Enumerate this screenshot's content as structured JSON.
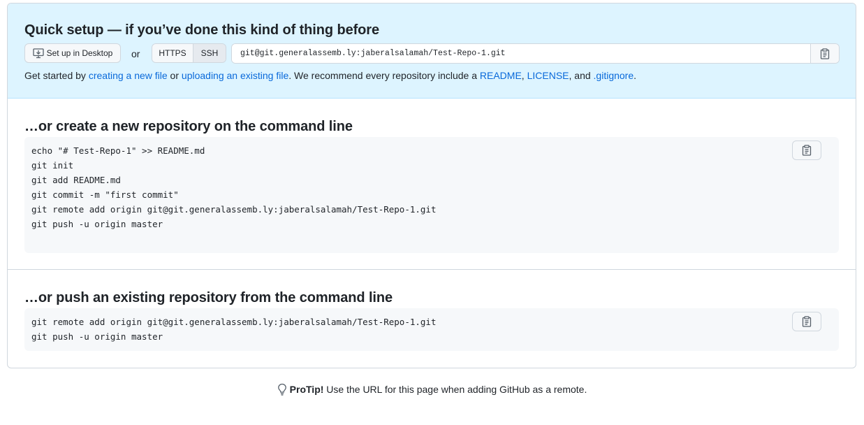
{
  "quick_setup": {
    "title": "Quick setup — if you’ve done this kind of thing before",
    "desktop_button_label": "Set up in Desktop",
    "or_label": "or",
    "protocols": [
      "HTTPS",
      "SSH"
    ],
    "selected_protocol": "SSH",
    "clone_url": "git@git.generalassemb.ly:jaberalsalamah/Test-Repo-1.git",
    "get_started": {
      "prefix": "Get started by ",
      "link_new_file": "creating a new file",
      "or_text": " or ",
      "link_upload": "uploading an existing file",
      "middle": ". We recommend every repository include a ",
      "link_readme": "README",
      "comma1": ", ",
      "link_license": "LICENSE",
      "and_text": ", and ",
      "link_gitignore": ".gitignore",
      "suffix": "."
    }
  },
  "create_new": {
    "title": "…or create a new repository on the command line",
    "code": "echo \"# Test-Repo-1\" >> README.md\ngit init\ngit add README.md\ngit commit -m \"first commit\"\ngit remote add origin git@git.generalassemb.ly:jaberalsalamah/Test-Repo-1.git\ngit push -u origin master"
  },
  "push_existing": {
    "title": "…or push an existing repository from the command line",
    "code": "git remote add origin git@git.generalassemb.ly:jaberalsalamah/Test-Repo-1.git\ngit push -u origin master"
  },
  "protip": {
    "label": "ProTip!",
    "text": " Use the URL for this page when adding GitHub as a remote."
  },
  "icons": {
    "desktop": "desktop-download-icon",
    "copy": "clipboard-icon",
    "protip": "light-bulb-icon"
  },
  "colors": {
    "quick_bg": "#ddf4ff",
    "link": "#0969da",
    "code_bg": "#f6f8fa",
    "border": "#d0d7de"
  }
}
